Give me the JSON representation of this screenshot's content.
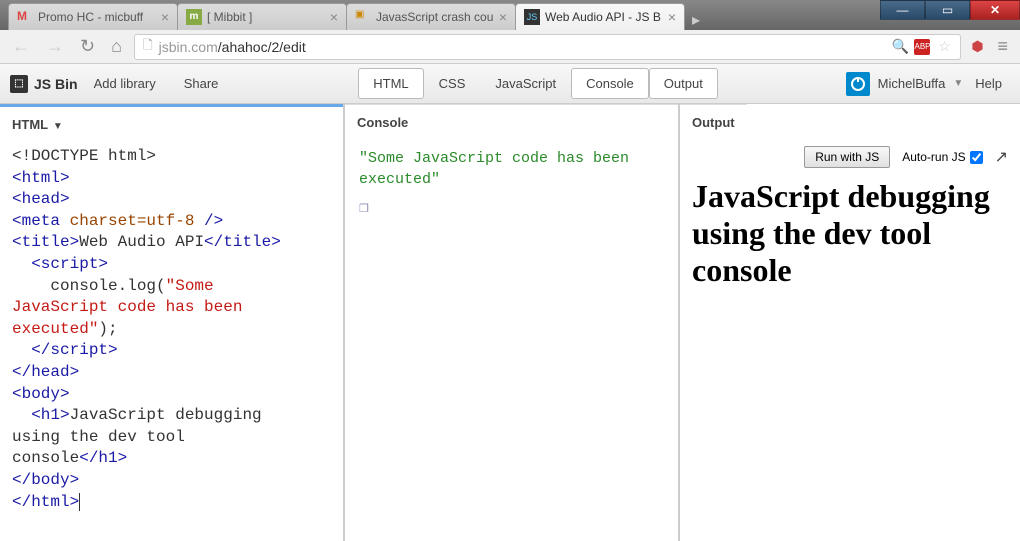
{
  "window": {
    "tabs": [
      {
        "title": "Promo HC - micbuff",
        "favicon": "gmail"
      },
      {
        "title": "[ Mibbit ]",
        "favicon": "mibbit"
      },
      {
        "title": "JavasScript crash cou",
        "favicon": "edx"
      },
      {
        "title": "Web Audio API - JS B",
        "favicon": "jsbin",
        "active": true
      }
    ]
  },
  "url": {
    "domain": "jsbin.com",
    "path": "/ahahoc/2/edit"
  },
  "jsbin": {
    "logo": "JS Bin",
    "menus": {
      "addlib": "Add library",
      "share": "Share"
    },
    "panels": {
      "html": "HTML",
      "css": "CSS",
      "js": "JavaScript",
      "console": "Console",
      "output": "Output"
    },
    "user": "MichelBuffa",
    "help": "Help"
  },
  "panes": {
    "html_label": "HTML",
    "console_label": "Console",
    "output_label": "Output"
  },
  "code": {
    "l1_doctype": "<!DOCTYPE html>",
    "l2_html_open": "<html>",
    "l3_head_open": "<head>",
    "l4_meta_tag": "<meta ",
    "l4_meta_attr": "charset=utf-8 ",
    "l4_meta_close": "/>",
    "l5_title_open": "<title>",
    "l5_title_text": "Web Audio API",
    "l5_title_close": "</title>",
    "l6_script_open": "  <script>",
    "l7a": "    console.log(",
    "l7b": "\"Some ",
    "l8": "JavaScript code has been ",
    "l9a": "executed\"",
    "l9b": ");",
    "l10_script_close": "  </script>",
    "l11_head_close": "</head>",
    "l12_body_open": "<body>",
    "l13_h1_open": "  <h1>",
    "l13_text1": "JavaScript debugging ",
    "l14_text2": "using the dev tool ",
    "l15_text3": "console",
    "l15_h1_close": "</h1>",
    "l16_body_close": "</body>",
    "l17_html_close": "</html>"
  },
  "console_output": "\"Some JavaScript code has been executed\"",
  "output": {
    "run_btn": "Run with JS",
    "autorun": "Auto-run JS",
    "heading": "JavaScript debugging using the dev tool console"
  }
}
